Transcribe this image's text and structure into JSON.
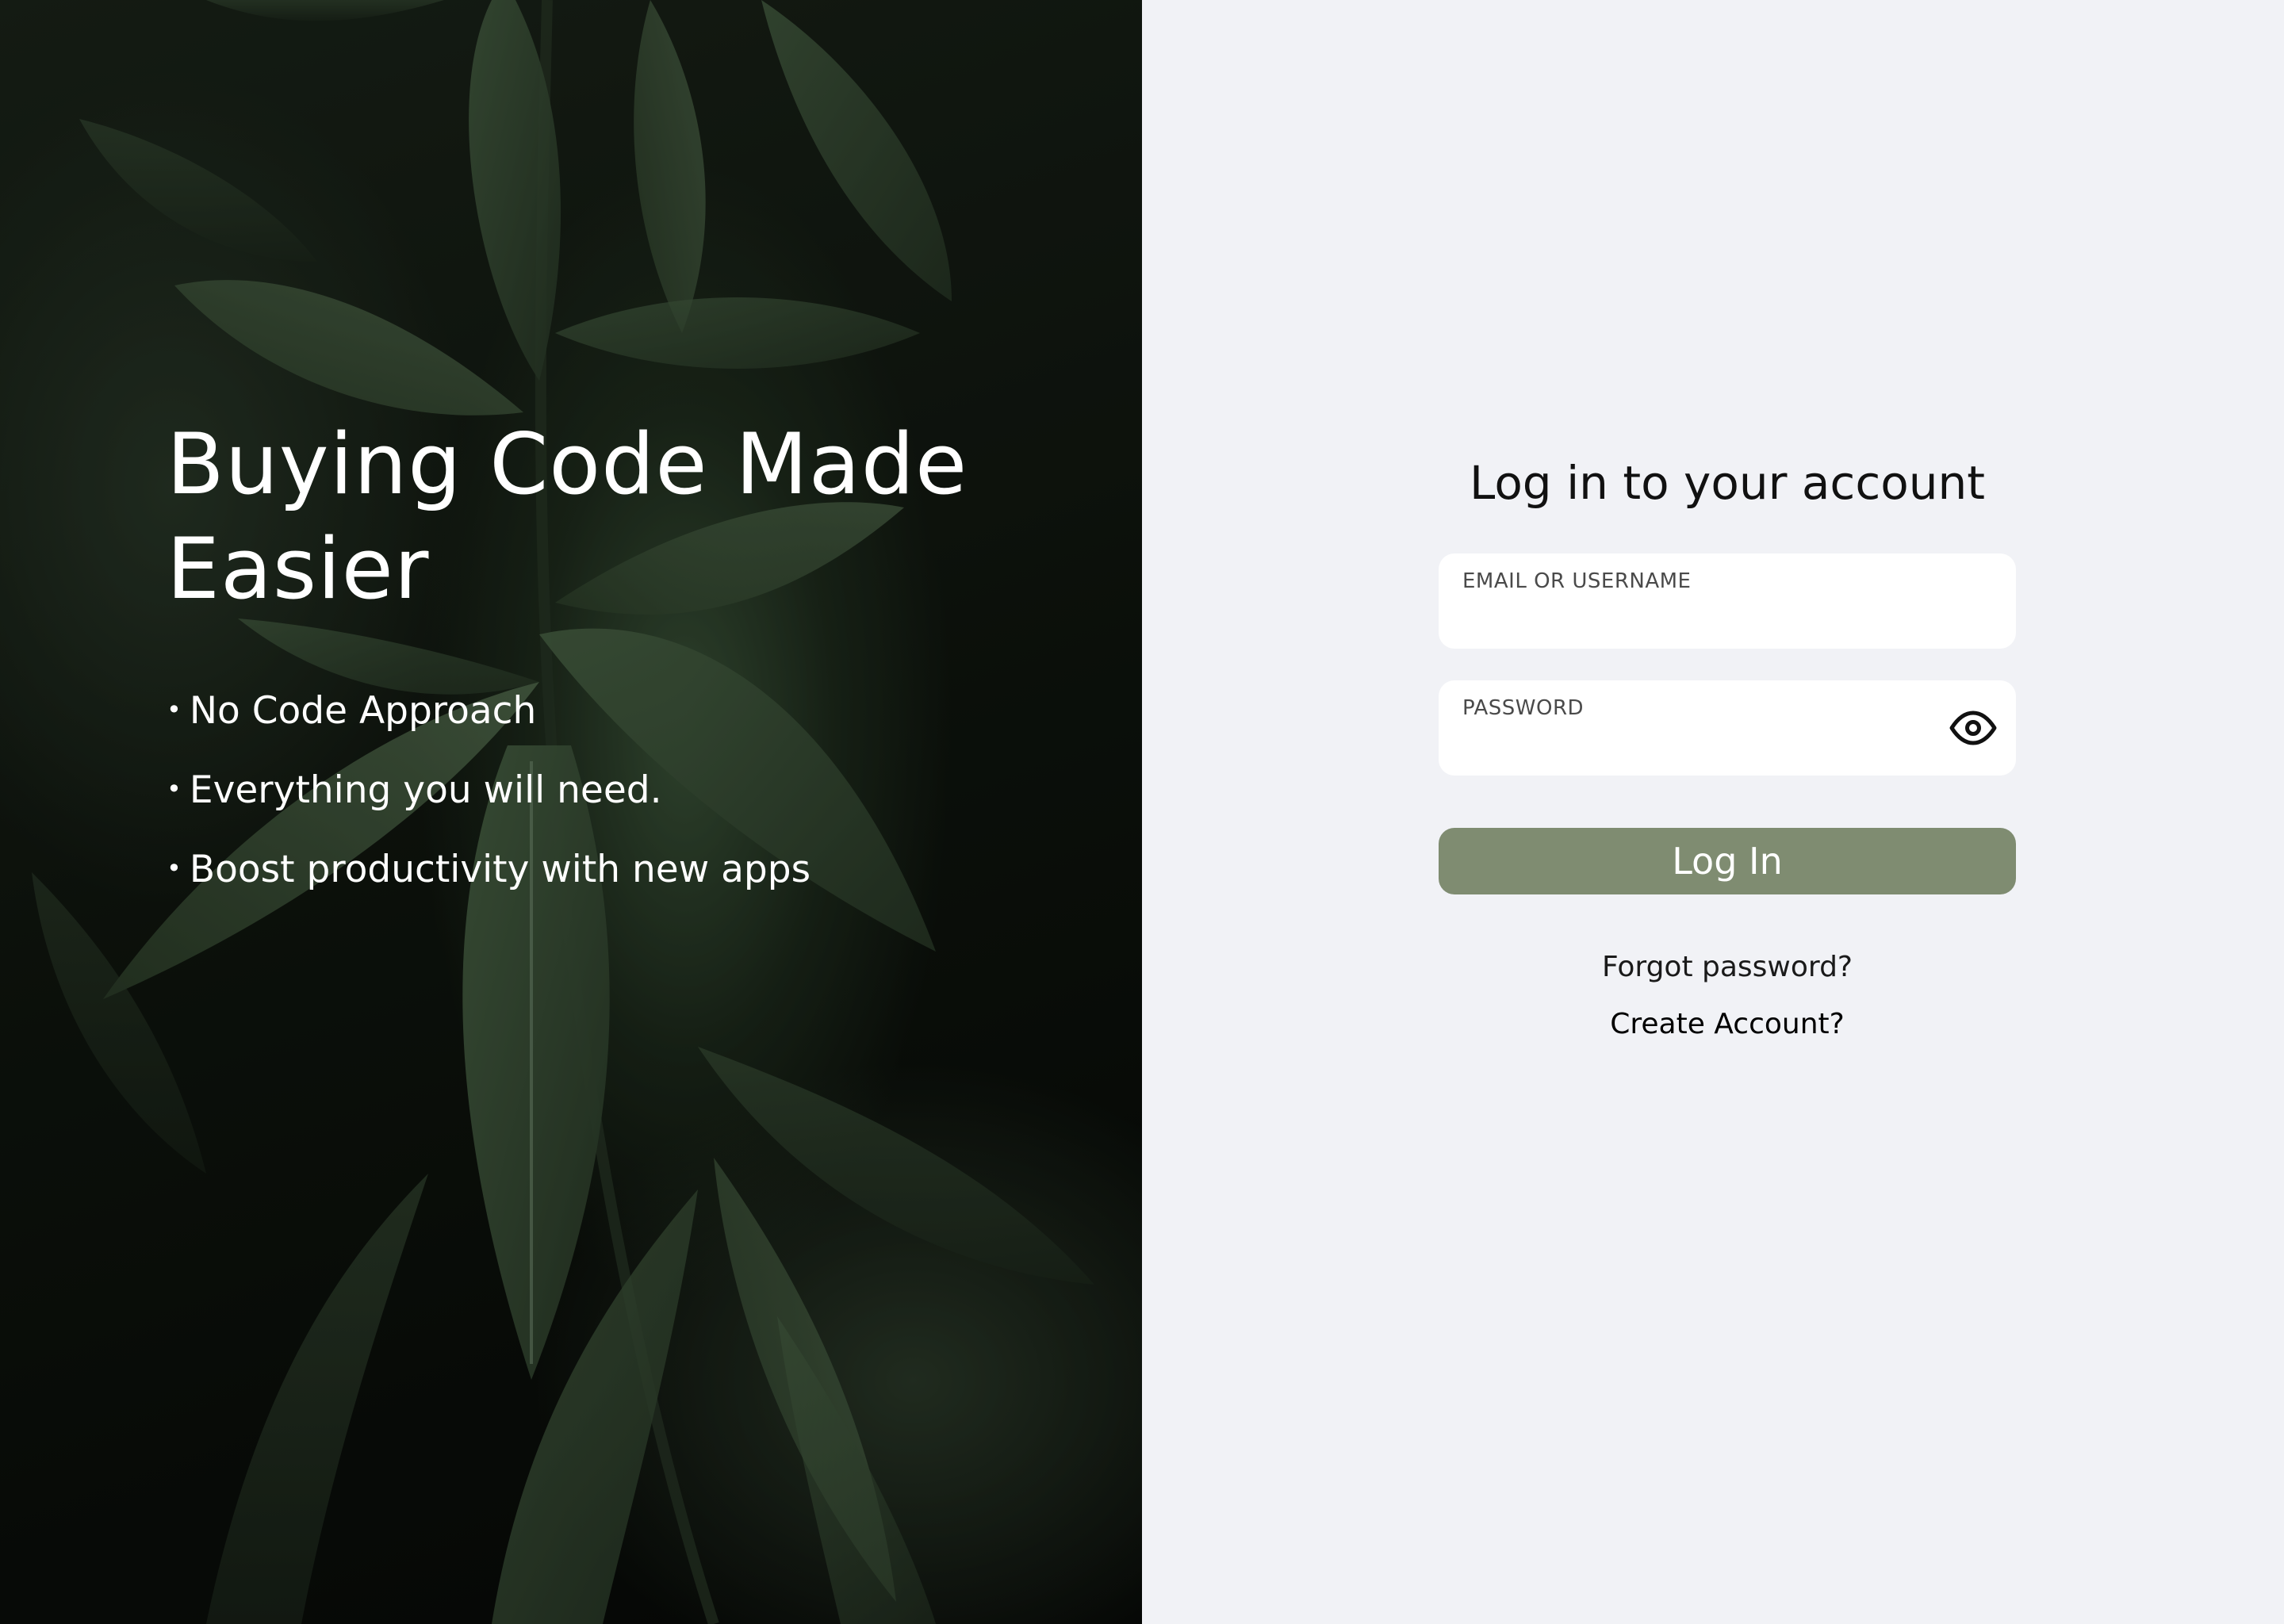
{
  "hero": {
    "title_line1": "Buying Code Made",
    "title_line2": "Easier",
    "bullets": [
      "No Code Approach",
      "Everything you will need.",
      "Boost productivity with new apps"
    ],
    "bullet_symbol": "•"
  },
  "login": {
    "title": "Log in to your account",
    "email_label": "EMAIL OR USERNAME",
    "email_value": "",
    "password_label": "PASSWORD",
    "password_value": "",
    "password_toggle_icon": "eye-icon",
    "submit_label": "Log In",
    "forgot_label": "Forgot password?",
    "create_label": "Create Account?"
  },
  "colors": {
    "right_panel_bg": "#f1f2f6",
    "button_bg": "#7f8c71",
    "button_text": "#ffffff",
    "hero_text": "#ffffff"
  }
}
